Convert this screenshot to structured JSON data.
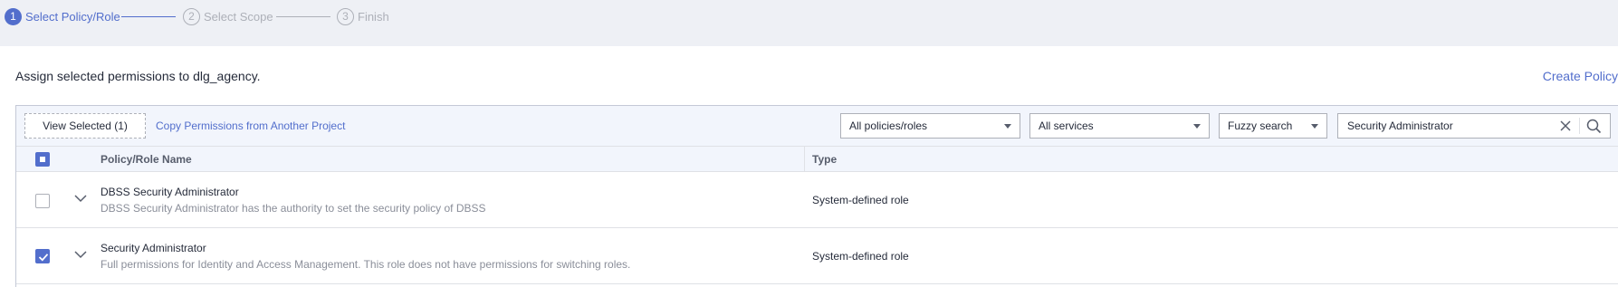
{
  "steps": [
    {
      "num": "1",
      "label": "Select Policy/Role",
      "state": "active"
    },
    {
      "num": "2",
      "label": "Select Scope",
      "state": "inactive"
    },
    {
      "num": "3",
      "label": "Finish",
      "state": "inactive"
    }
  ],
  "header": {
    "assign_text": "Assign selected permissions to dlg_agency.",
    "create_policy": "Create Policy"
  },
  "toolbar": {
    "view_selected": "View Selected (1)",
    "copy_permissions": "Copy Permissions from Another Project",
    "policy_filter": "All policies/roles",
    "service_filter": "All services",
    "search_mode": "Fuzzy search",
    "search_value": "Security Administrator"
  },
  "table": {
    "columns": [
      "Policy/Role Name",
      "Type"
    ],
    "select_all_state": "partial",
    "rows": [
      {
        "name": "DBSS Security Administrator",
        "description": "DBSS Security Administrator has the authority to set the security policy of DBSS",
        "type": "System-defined role",
        "checked": false
      },
      {
        "name": "Security Administrator",
        "description": "Full permissions for Identity and Access Management. This role does not have permissions for switching roles.",
        "type": "System-defined role",
        "checked": true
      }
    ]
  },
  "colors": {
    "accent": "#526ecc",
    "muted": "#adb0b8",
    "header_bg": "#eef0f5",
    "toolbar_bg": "#f2f5fc"
  }
}
